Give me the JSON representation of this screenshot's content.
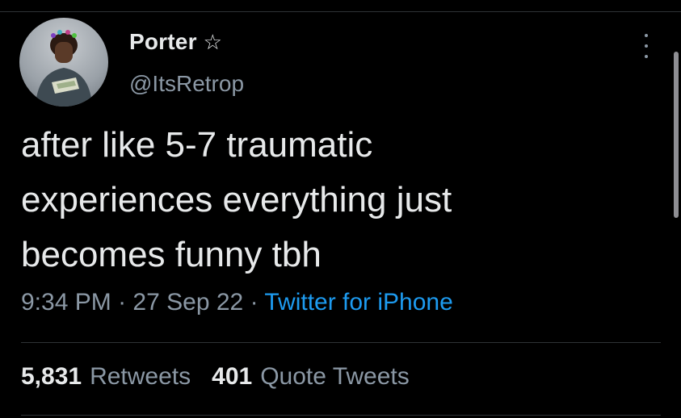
{
  "profile": {
    "display_name": "Porter",
    "verified_icon": "star-outline-icon",
    "handle": "@ItsRetrop"
  },
  "tweet": {
    "text_lines": [
      "after like 5-7 traumatic",
      "experiences everything just",
      "becomes funny tbh"
    ],
    "time": "9:34 PM",
    "separator": "·",
    "date": "27 Sep 22",
    "source": "Twitter for iPhone"
  },
  "stats": {
    "retweets_count": "5,831",
    "retweets_label": "Retweets",
    "quotes_count": "401",
    "quotes_label": "Quote Tweets"
  },
  "colors": {
    "background": "#000000",
    "text_primary": "#e7e9ea",
    "text_secondary": "#8b98a5",
    "link": "#1d9bf0",
    "divider": "#2f3336"
  }
}
